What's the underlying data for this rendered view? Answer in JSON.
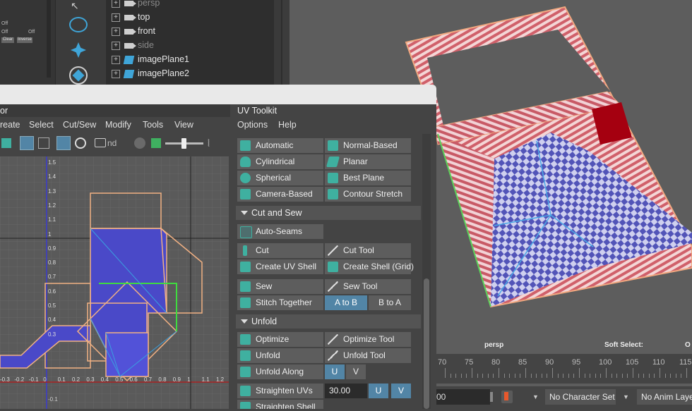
{
  "outliner": {
    "items": [
      {
        "label": "persp",
        "type": "camera",
        "dim": true
      },
      {
        "label": "top",
        "type": "camera",
        "dim": false
      },
      {
        "label": "front",
        "type": "camera",
        "dim": false
      },
      {
        "label": "side",
        "type": "camera",
        "dim": true
      },
      {
        "label": "imagePlane1",
        "type": "imageplane",
        "dim": false
      },
      {
        "label": "imagePlane2",
        "type": "imageplane",
        "dim": false
      }
    ],
    "left_panel": {
      "off1": "Off",
      "off2": "Off",
      "off3": "Off",
      "clear": "Clear",
      "inverse": "Inverse"
    }
  },
  "uv_editor": {
    "title_fragment": "or",
    "menu": [
      "reate",
      "Select",
      "Cut/Sew",
      "Modify",
      "Tools",
      "View"
    ],
    "toolbar_text": "nd",
    "axis_y": [
      "1.5",
      "1.4",
      "1.3",
      "1.2",
      "1.1",
      "1",
      "0.9",
      "0.8",
      "0.7",
      "0.6",
      "0.5",
      "0.4",
      "0.3"
    ],
    "axis_x": [
      "-0.3",
      "-0.2",
      "-0.1",
      "0",
      "0.1",
      "0.2",
      "0.3",
      "0.4",
      "0.5",
      "0.6",
      "0.7",
      "0.8",
      "0.9",
      "1",
      "1.1",
      "1.2"
    ],
    "axis_neg": "-0.1"
  },
  "uv_toolkit": {
    "tab": "UV Toolkit",
    "menu": [
      "Options",
      "Help"
    ],
    "projections": [
      [
        "Automatic",
        "Normal-Based"
      ],
      [
        "Cylindrical",
        "Planar"
      ],
      [
        "Spherical",
        "Best Plane"
      ],
      [
        "Camera-Based",
        "Contour Stretch"
      ]
    ],
    "cut_and_sew": {
      "title": "Cut and Sew",
      "auto_seams": "Auto-Seams",
      "cut": "Cut",
      "cut_tool": "Cut Tool",
      "create_uv_shell": "Create UV Shell",
      "create_shell_grid": "Create Shell (Grid)",
      "sew": "Sew",
      "sew_tool": "Sew Tool",
      "stitch_together": "Stitch Together",
      "a_to_b": "A to B",
      "b_to_a": "B to A"
    },
    "unfold": {
      "title": "Unfold",
      "optimize": "Optimize",
      "optimize_tool": "Optimize Tool",
      "unfold": "Unfold",
      "unfold_tool": "Unfold Tool",
      "unfold_along": "Unfold Along",
      "u": "U",
      "v": "V",
      "straighten_uvs": "Straighten UVs",
      "straighten_value": "30.00",
      "straighten_shell": "Straighten Shell"
    }
  },
  "viewport": {
    "camera_label": "persp",
    "soft_select": "Soft Select:",
    "soft_select_value": "O"
  },
  "timeline": {
    "ticks": [
      "70",
      "75",
      "80",
      "85",
      "90",
      "95",
      "100",
      "105",
      "110",
      "115"
    ],
    "frame_fragment": "00",
    "character_set": "No Character Set",
    "anim_layer": "No Anim Laye"
  },
  "colors": {
    "accent_blue": "#5285a6",
    "uv_shell_fill": "#4a49c8",
    "uv_outline": "#f2b183",
    "uv_selected": "#3fdc3f"
  }
}
